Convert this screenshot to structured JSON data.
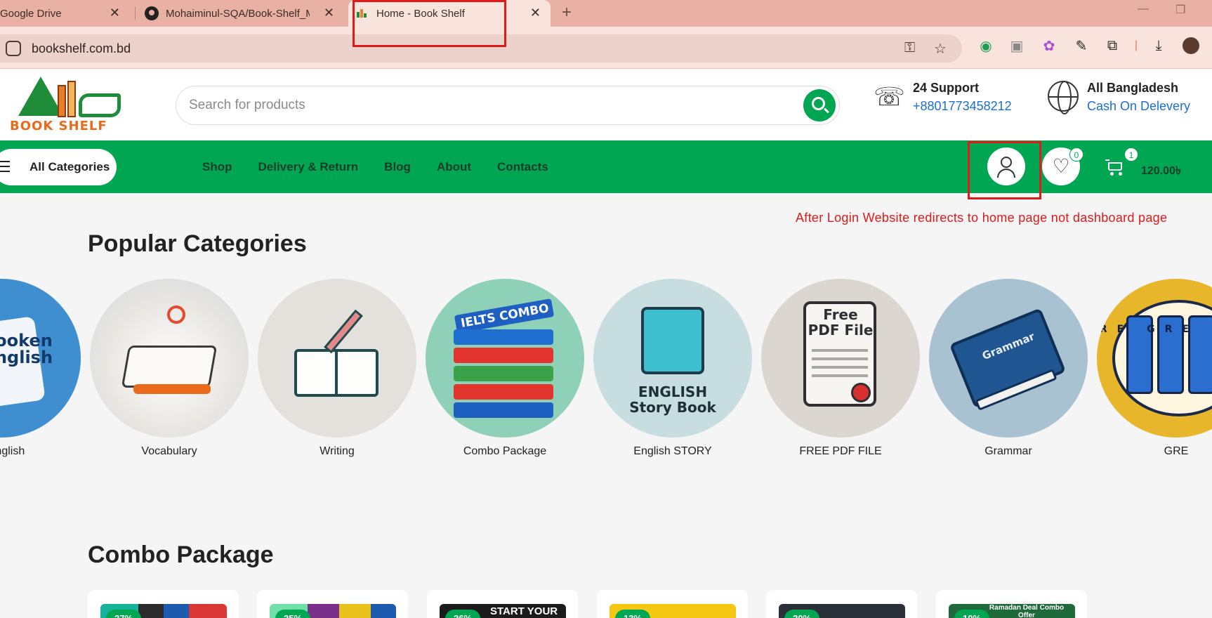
{
  "browser": {
    "tabs": [
      {
        "title": "Google Drive"
      },
      {
        "title": "Mohaiminul-SQA/Book-Shelf_M"
      },
      {
        "title": "Home - Book Shelf"
      }
    ],
    "new_tab": "+",
    "url": "bookshelf.com.bd",
    "window_controls": [
      "—",
      "❐"
    ]
  },
  "site": {
    "logo_text": "BOOK SHELF",
    "search_placeholder": "Search for products",
    "support": {
      "title": "24 Support",
      "phone": "+8801773458212"
    },
    "delivery": {
      "title": "All Bangladesh",
      "subtitle": "Cash On Delevery"
    },
    "nav": {
      "all_categories": "All Categories",
      "links": [
        "Shop",
        "Delivery & Return",
        "Blog",
        "About",
        "Contacts"
      ],
      "wishlist_count": "0",
      "cart_count": "1",
      "cart_total": "120.00৳"
    }
  },
  "annotation": {
    "note": "After Login Website redirects to home page not dashboard page"
  },
  "popular": {
    "title": "Popular Categories",
    "items": [
      {
        "name": "English",
        "art": "ooken\nnglish"
      },
      {
        "name": "Vocabulary",
        "art": ""
      },
      {
        "name": "Writing",
        "art": ""
      },
      {
        "name": "Combo Package",
        "art": "IELTS COMBO"
      },
      {
        "name": "English STORY",
        "art": "ENGLISH\nStory Book"
      },
      {
        "name": "FREE PDF FILE",
        "art": "Free\nPDF File"
      },
      {
        "name": "Grammar",
        "art": "Grammar"
      },
      {
        "name": "GRE",
        "art": "GRE GRE GRE"
      }
    ]
  },
  "combo": {
    "title": "Combo Package",
    "discounts": [
      "27%",
      "25%",
      "26%",
      "13%",
      "20%",
      "10%"
    ],
    "thumb_texts": [
      "",
      "",
      "START YOUR",
      "",
      "",
      "Ramadan Deal Combo Offer"
    ]
  },
  "colors": {
    "brand_green": "#00a651",
    "annotation_red": "#e01a1a",
    "link_blue": "#1a6fd6"
  }
}
